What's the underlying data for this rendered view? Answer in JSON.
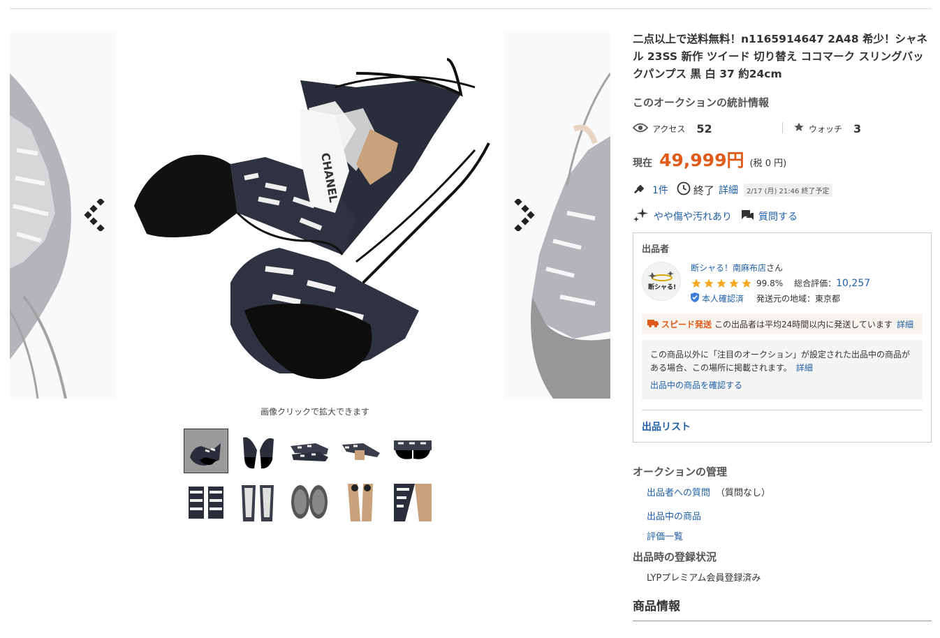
{
  "gallery": {
    "zoom_hint": "画像クリックで拡大できます",
    "main_image_brand_text": "CHANEL",
    "thumbnails": [
      {
        "name": "thumb-1",
        "active": true
      },
      {
        "name": "thumb-2",
        "active": false
      },
      {
        "name": "thumb-3",
        "active": false
      },
      {
        "name": "thumb-4",
        "active": false
      },
      {
        "name": "thumb-5",
        "active": false
      },
      {
        "name": "thumb-6",
        "active": false
      },
      {
        "name": "thumb-7",
        "active": false
      },
      {
        "name": "thumb-8",
        "active": false
      },
      {
        "name": "thumb-9",
        "active": false
      },
      {
        "name": "thumb-10",
        "active": false
      }
    ]
  },
  "item": {
    "title": "二点以上で送料無料！n1165914647 2A48 希少！シャネル 23SS 新作 ツイード 切り替え ココマーク スリングバックパンプス 黒 白 37 約24cm"
  },
  "stats": {
    "heading": "このオークションの統計情報",
    "access_label": "アクセス",
    "access_value": "52",
    "watch_label": "ウォッチ",
    "watch_value": "3"
  },
  "price": {
    "label": "現在",
    "value": "49,999円",
    "tax": "(税 0 円)"
  },
  "meta": {
    "bids": "1件",
    "end_label": "終了",
    "detail_link": "詳細",
    "end_time": "2/17 (月) 21:46 終了予定"
  },
  "condition": {
    "label": "やや傷や汚れあり",
    "question_link": "質問する"
  },
  "seller": {
    "heading": "出品者",
    "avatar_text": "断シャる!",
    "name": "断シャる！南麻布店",
    "name_suffix": "さん",
    "rating_pct": "99.8%",
    "rating_total_label": "総合評価：",
    "rating_total": "10,257",
    "verified": "本人確認済",
    "ship_from": "発送元の地域：東京都",
    "speed_label": "スピード発送",
    "speed_text": "この出品者は平均24時間以内に発送しています",
    "speed_detail": "詳細",
    "notice_text": "この商品以外に「注目のオークション」が設定された出品中の商品がある場合、この場所に掲載されます。",
    "notice_detail": "詳細",
    "notice_link": "出品中の商品を確認する",
    "listing_link": "出品リスト"
  },
  "management": {
    "heading": "オークションの管理",
    "question_link": "出品者への質問",
    "question_note": "（質問なし）",
    "items_link": "出品中の商品",
    "ratings_link": "評価一覧"
  },
  "registration": {
    "heading": "出品時の登録状況",
    "value": "LYPプレミアム会員登録済み"
  },
  "product_info": {
    "heading": "商品情報"
  },
  "colors": {
    "price": "#e05a1a",
    "link": "#1f5fa8",
    "star": "#f5a623"
  }
}
